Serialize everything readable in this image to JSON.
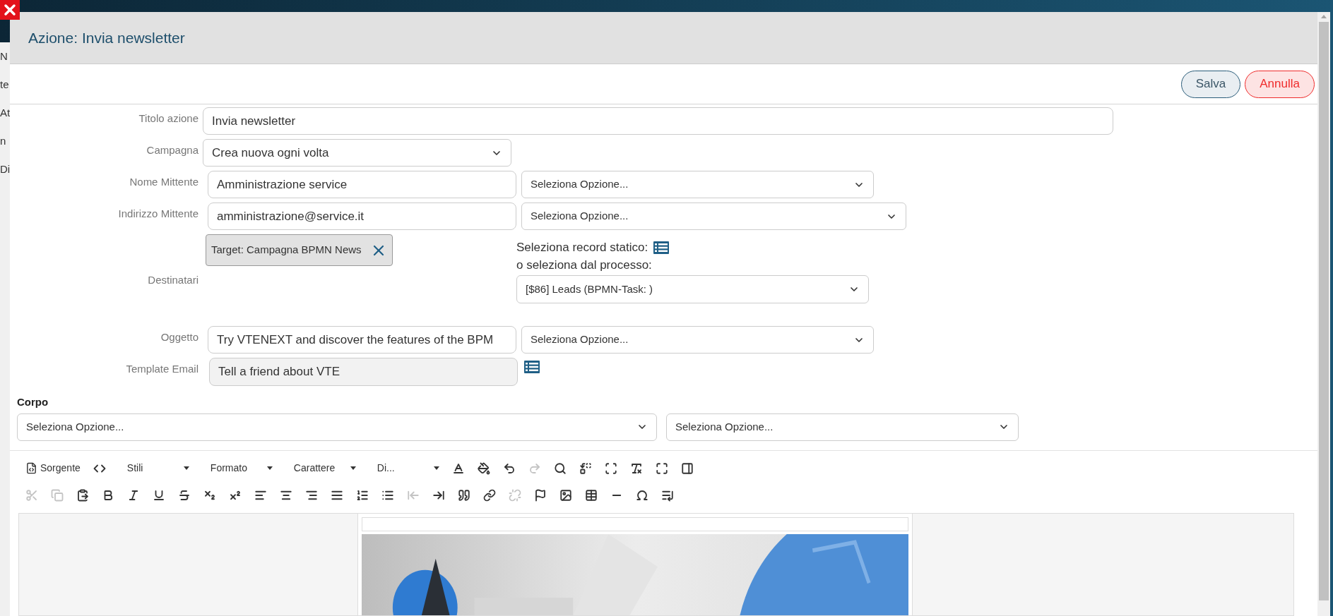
{
  "background": {
    "fragments": [
      "N",
      "te",
      "At",
      "n",
      "Di"
    ]
  },
  "dialog": {
    "title": "Azione: Invia newsletter",
    "buttons": [
      {
        "label": "Salva",
        "kind": "save"
      },
      {
        "label": "Annulla",
        "kind": "cancel"
      }
    ]
  },
  "form": {
    "fields": [
      {
        "kind": "wide_text",
        "label": "Titolo azione",
        "value": "Invia newsletter"
      },
      {
        "kind": "select",
        "label": "Campagna",
        "value": "Crea nuova ogni volta"
      },
      {
        "kind": "text_with_select",
        "label": "Nome Mittente",
        "value": "Amministrazione service",
        "select": "Seleziona Opzione..."
      },
      {
        "kind": "text_with_select",
        "label": "Indirizzo Mittente",
        "value": "amministrazione@service.it",
        "select": "Seleziona Opzione..."
      },
      {
        "kind": "recipients",
        "label": "Destinatari",
        "chip": "Target: Campagna BPMN News",
        "static_label": "Seleziona record statico:",
        "process_label": "o seleziona dal processo:",
        "select": "[$86] Leads (BPMN-Task: )"
      },
      {
        "kind": "text_with_select",
        "label": "Oggetto",
        "value": "Try VTENEXT and discover the features of the BPM",
        "select": "Seleziona Opzione..."
      },
      {
        "kind": "readonly_with_picker",
        "label": "Template Email",
        "value": "Tell a friend about VTE"
      }
    ]
  },
  "body": {
    "label": "Corpo",
    "selects": [
      "Seleziona Opzione...",
      "Seleziona Opzione..."
    ]
  },
  "editor": {
    "toolbar": [
      [
        {
          "kind": "labeled",
          "label": "Sorgente"
        },
        {
          "kind": "icon",
          "disabled": false
        },
        {
          "kind": "dropdown",
          "label": "Stili"
        },
        {
          "kind": "dropdown",
          "label": "Formato"
        },
        {
          "kind": "dropdown",
          "label": "Carattere"
        },
        {
          "kind": "dropdown",
          "label": "Di..."
        },
        {
          "kind": "icon",
          "disabled": false
        },
        {
          "kind": "icon",
          "disabled": false
        },
        {
          "kind": "icon",
          "disabled": false
        },
        {
          "kind": "icon",
          "disabled": true
        },
        {
          "kind": "icon",
          "disabled": false
        },
        {
          "kind": "icon",
          "disabled": false
        },
        {
          "kind": "icon",
          "disabled": false
        },
        {
          "kind": "icon",
          "disabled": false
        },
        {
          "kind": "icon",
          "disabled": false
        },
        {
          "kind": "icon",
          "disabled": false
        }
      ],
      [
        {
          "kind": "icon",
          "disabled": true
        },
        {
          "kind": "icon",
          "disabled": true
        },
        {
          "kind": "icon",
          "disabled": false
        },
        {
          "kind": "icon",
          "disabled": false
        },
        {
          "kind": "icon",
          "disabled": false
        },
        {
          "kind": "icon",
          "disabled": false
        },
        {
          "kind": "icon",
          "disabled": false
        },
        {
          "kind": "icon",
          "disabled": false
        },
        {
          "kind": "icon",
          "disabled": false
        },
        {
          "kind": "icon",
          "disabled": false
        },
        {
          "kind": "icon",
          "disabled": false
        },
        {
          "kind": "icon",
          "disabled": false
        },
        {
          "kind": "icon",
          "disabled": false
        },
        {
          "kind": "icon",
          "disabled": false
        },
        {
          "kind": "icon",
          "disabled": false
        },
        {
          "kind": "icon",
          "disabled": true
        },
        {
          "kind": "icon",
          "disabled": false
        },
        {
          "kind": "icon",
          "disabled": false
        },
        {
          "kind": "icon",
          "disabled": false
        },
        {
          "kind": "icon",
          "disabled": true
        },
        {
          "kind": "icon",
          "disabled": false
        },
        {
          "kind": "icon",
          "disabled": false
        },
        {
          "kind": "icon",
          "disabled": false
        },
        {
          "kind": "icon",
          "disabled": false
        },
        {
          "kind": "icon",
          "disabled": false
        },
        {
          "kind": "icon",
          "disabled": false
        }
      ]
    ]
  }
}
